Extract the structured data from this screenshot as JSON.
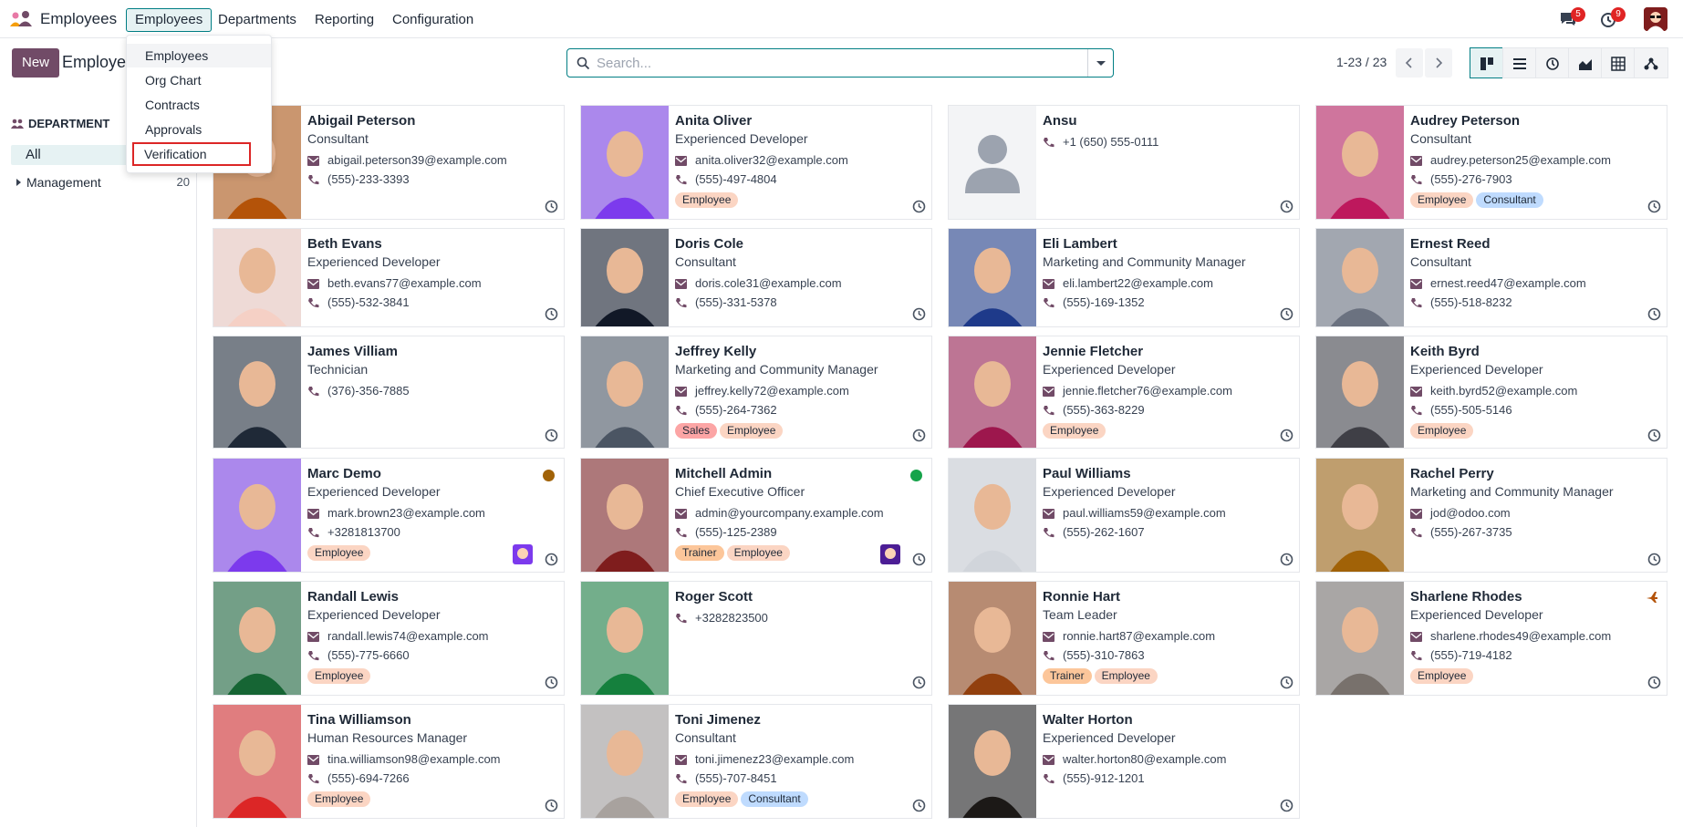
{
  "app": {
    "name": "Employees"
  },
  "nav": {
    "menus": [
      "Employees",
      "Departments",
      "Reporting",
      "Configuration"
    ],
    "messages_badge": "5",
    "activity_badge": "9"
  },
  "dropdown": [
    "Employees",
    "Org Chart",
    "Contracts",
    "Approvals",
    "Verification"
  ],
  "control": {
    "new_label": "New",
    "breadcrumb": "Employees",
    "search_placeholder": "Search...",
    "pager": "1-23 / 23"
  },
  "sidebar": {
    "header": "DEPARTMENT",
    "all": "All",
    "items": [
      {
        "label": "Management",
        "count": "20"
      }
    ]
  },
  "colors": {
    "accent": "#017e84",
    "brand": "#714b67",
    "tag_employee": "#fbd5c3",
    "tag_consultant": "#bfdbfe",
    "tag_sales": "#fca5a5",
    "tag_trainer": "#fcc69a"
  },
  "employees": [
    {
      "name": "Abigail Peterson",
      "job": "Consultant",
      "email": "abigail.peterson39@example.com",
      "phone": "(555)-233-3393",
      "tags": []
    },
    {
      "name": "Anita Oliver",
      "job": "Experienced Developer",
      "email": "anita.oliver32@example.com",
      "phone": "(555)-497-4804",
      "tags": [
        "Employee"
      ]
    },
    {
      "name": "Ansu",
      "job": "",
      "email": "",
      "phone": "+1 (650) 555-0111",
      "tags": []
    },
    {
      "name": "Audrey Peterson",
      "job": "Consultant",
      "email": "audrey.peterson25@example.com",
      "phone": "(555)-276-7903",
      "tags": [
        "Employee",
        "Consultant"
      ]
    },
    {
      "name": "Beth Evans",
      "job": "Experienced Developer",
      "email": "beth.evans77@example.com",
      "phone": "(555)-532-3841",
      "tags": []
    },
    {
      "name": "Doris Cole",
      "job": "Consultant",
      "email": "doris.cole31@example.com",
      "phone": "(555)-331-5378",
      "tags": []
    },
    {
      "name": "Eli Lambert",
      "job": "Marketing and Community Manager",
      "email": "eli.lambert22@example.com",
      "phone": "(555)-169-1352",
      "tags": []
    },
    {
      "name": "Ernest Reed",
      "job": "Consultant",
      "email": "ernest.reed47@example.com",
      "phone": "(555)-518-8232",
      "tags": []
    },
    {
      "name": "James Villiam",
      "job": "Technician",
      "email": "",
      "phone": "(376)-356-7885",
      "tags": []
    },
    {
      "name": "Jeffrey Kelly",
      "job": "Marketing and Community Manager",
      "email": "jeffrey.kelly72@example.com",
      "phone": "(555)-264-7362",
      "tags": [
        "Sales",
        "Employee"
      ]
    },
    {
      "name": "Jennie Fletcher",
      "job": "Experienced Developer",
      "email": "jennie.fletcher76@example.com",
      "phone": "(555)-363-8229",
      "tags": [
        "Employee"
      ]
    },
    {
      "name": "Keith Byrd",
      "job": "Experienced Developer",
      "email": "keith.byrd52@example.com",
      "phone": "(555)-505-5146",
      "tags": [
        "Employee"
      ]
    },
    {
      "name": "Marc Demo",
      "job": "Experienced Developer",
      "email": "mark.brown23@example.com",
      "phone": "+3281813700",
      "tags": [
        "Employee"
      ],
      "status": "away"
    },
    {
      "name": "Mitchell Admin",
      "job": "Chief Executive Officer",
      "email": "admin@yourcompany.example.com",
      "phone": "(555)-125-2389",
      "tags": [
        "Trainer",
        "Employee"
      ],
      "status": "online"
    },
    {
      "name": "Paul Williams",
      "job": "Experienced Developer",
      "email": "paul.williams59@example.com",
      "phone": "(555)-262-1607",
      "tags": []
    },
    {
      "name": "Rachel Perry",
      "job": "Marketing and Community Manager",
      "email": "jod@odoo.com",
      "phone": "(555)-267-3735",
      "tags": []
    },
    {
      "name": "Randall Lewis",
      "job": "Experienced Developer",
      "email": "randall.lewis74@example.com",
      "phone": "(555)-775-6660",
      "tags": [
        "Employee"
      ]
    },
    {
      "name": "Roger Scott",
      "job": "",
      "email": "",
      "phone": "+3282823500",
      "tags": []
    },
    {
      "name": "Ronnie Hart",
      "job": "Team Leader",
      "email": "ronnie.hart87@example.com",
      "phone": "(555)-310-7863",
      "tags": [
        "Trainer",
        "Employee"
      ]
    },
    {
      "name": "Sharlene Rhodes",
      "job": "Experienced Developer",
      "email": "sharlene.rhodes49@example.com",
      "phone": "(555)-719-4182",
      "tags": [
        "Employee"
      ],
      "absent": true
    },
    {
      "name": "Tina Williamson",
      "job": "Human Resources Manager",
      "email": "tina.williamson98@example.com",
      "phone": "(555)-694-7266",
      "tags": [
        "Employee"
      ]
    },
    {
      "name": "Toni Jimenez",
      "job": "Consultant",
      "email": "toni.jimenez23@example.com",
      "phone": "(555)-707-8451",
      "tags": [
        "Employee",
        "Consultant"
      ]
    },
    {
      "name": "Walter Horton",
      "job": "Experienced Developer",
      "email": "walter.horton80@example.com",
      "phone": "(555)-912-1201",
      "tags": []
    }
  ]
}
